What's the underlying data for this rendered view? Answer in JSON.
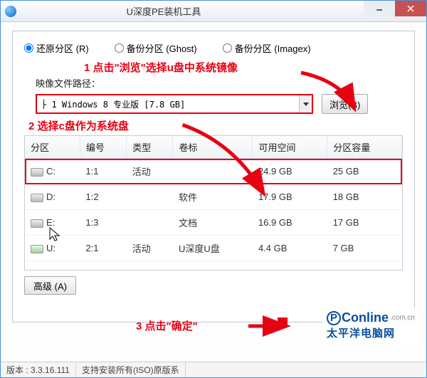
{
  "window": {
    "title": "U深度PE装机工具"
  },
  "radios": {
    "restore": "还原分区 (R)",
    "backup": "备份分区 (Ghost)",
    "imagex": "备份分区 (Imagex)"
  },
  "annotations": {
    "a1": "1 点击\"浏览\"选择u盘中系统镜像",
    "a2": "2 选择c盘作为系统盘",
    "a3": "3 点击\"确定\""
  },
  "path": {
    "label": "映像文件路径：",
    "value": "├ 1 Windows 8 专业版 [7.8 GB]"
  },
  "buttons": {
    "browse": "浏览(B)",
    "advanced": "高级 (A)"
  },
  "table": {
    "headers": {
      "part": "分区",
      "num": "编号",
      "type": "类型",
      "label": "卷标",
      "free": "可用空间",
      "size": "分区容量"
    },
    "rows": [
      {
        "drive": "C:",
        "num": "1:1",
        "type": "活动",
        "label": "",
        "free": "24.9 GB",
        "size": "25 GB",
        "icon": "hdd"
      },
      {
        "drive": "D:",
        "num": "1:2",
        "type": "",
        "label": "软件",
        "free": "17.9 GB",
        "size": "18 GB",
        "icon": "hdd"
      },
      {
        "drive": "E:",
        "num": "1:3",
        "type": "",
        "label": "文档",
        "free": "16.9 GB",
        "size": "17 GB",
        "icon": "hdd"
      },
      {
        "drive": "U:",
        "num": "2:1",
        "type": "活动",
        "label": "U深度U盘",
        "free": "4.4 GB",
        "size": "7 GB",
        "icon": "usb"
      }
    ]
  },
  "status": {
    "version_label": "版本 :",
    "version": "3.3.16.111",
    "note": "支持安装所有(ISO)原版系"
  },
  "watermark": {
    "brand": "PConline",
    "domain": ".com.cn",
    "cn": "太平洋电脑网"
  }
}
